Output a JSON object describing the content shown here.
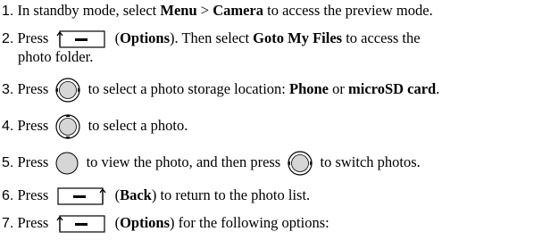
{
  "steps": [
    {
      "num": "1.",
      "pre": "In standby mode, select ",
      "b1": "Menu",
      "mid": " > ",
      "b2": "Camera",
      "post": " to access the preview mode."
    },
    {
      "num": "2.",
      "pre": "Press",
      "key": "left-softkey-icon",
      "paren_open": " (",
      "b1": "Options",
      "paren_close": "). Then select ",
      "b2": "Goto My Files",
      "post": " to access the",
      "cont": "photo folder."
    },
    {
      "num": "3.",
      "pre": "Press",
      "key": "nav-left-right-icon",
      "mid": " to select a photo storage location: ",
      "b1": "Phone",
      "or": " or ",
      "b2": "microSD card",
      "post": "."
    },
    {
      "num": "4.",
      "pre": "Press",
      "key": "nav-up-down-icon",
      "post": " to select a photo."
    },
    {
      "num": "5.",
      "pre": "Press",
      "key": "ok-key-icon",
      "mid": " to view the photo, and then press",
      "key2": "nav-left-right-icon",
      "post": " to switch photos."
    },
    {
      "num": "6.",
      "pre": "Press",
      "key": "right-softkey-icon",
      "paren_open": " (",
      "b1": "Back",
      "post": ") to return to the photo list."
    },
    {
      "num": "7.",
      "pre": "Press",
      "key": "left-softkey-icon",
      "paren_open": " (",
      "b1": "Options",
      "post": ") for the following options:"
    }
  ]
}
